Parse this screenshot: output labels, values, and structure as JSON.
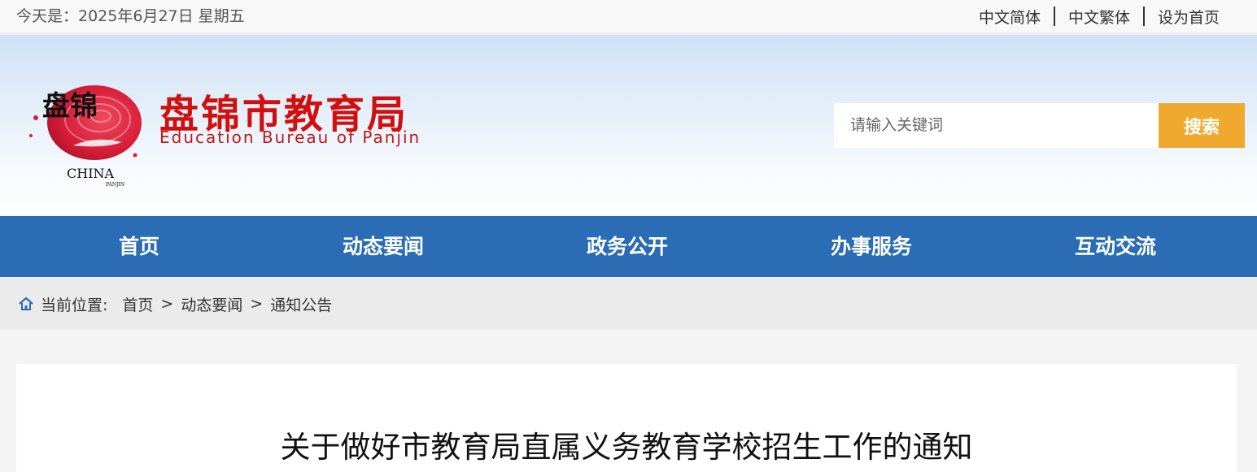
{
  "topbar": {
    "date_text": "今天是：2025年6月27日 星期五",
    "links": [
      "中文简体",
      "中文繁体",
      "设为首页"
    ]
  },
  "header": {
    "logo_text": "盘锦",
    "logo_sub": "CHINA",
    "logo_small": "PANJIN",
    "title": "盘锦市教育局",
    "subtitle": "Education Bureau of Panjin",
    "search_placeholder": "请输入关键词",
    "search_button": "搜索"
  },
  "nav": {
    "items": [
      "首页",
      "动态要闻",
      "政务公开",
      "办事服务",
      "互动交流"
    ]
  },
  "breadcrumb": {
    "label": "当前位置:",
    "items": [
      "首页",
      "动态要闻",
      "通知公告"
    ],
    "separator": ">"
  },
  "article": {
    "title": "关于做好市教育局直属义务教育学校招生工作的通知"
  },
  "colors": {
    "nav_bg": "#2a6db4",
    "search_button": "#f0a92f",
    "title_red": "#d01010"
  }
}
